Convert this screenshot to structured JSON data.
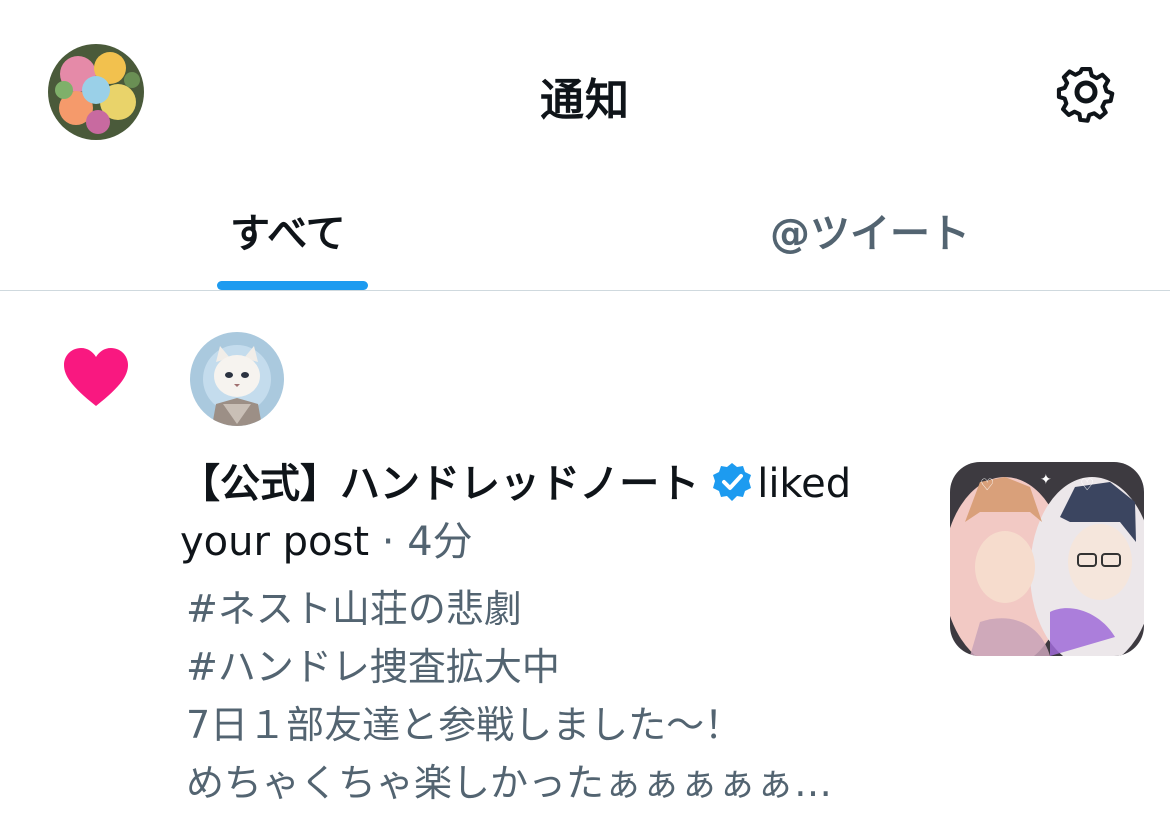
{
  "header": {
    "title": "通知",
    "settings_icon": "gear-icon",
    "avatar_icon": "profile-avatar"
  },
  "tabs": [
    {
      "label": "すべて",
      "selected": true
    },
    {
      "label": "@ツイート",
      "selected": false
    }
  ],
  "notification": {
    "type_icon": "heart-icon",
    "account_name": "【公式】ハンドレッドノート",
    "verified_icon": "verified-badge-icon",
    "action": "liked your post",
    "separator": "·",
    "time": "4分",
    "post_text": "#ネスト山荘の悲劇\n#ハンドレ捜査拡大中\n7日１部友達と参戦しました〜！\nめちゃくちゃ楽しかったぁぁぁぁぁ…"
  },
  "colors": {
    "accent": "#1d9bf0",
    "like": "#f91880",
    "muted_text": "#536471",
    "primary_text": "#0f1419",
    "divider": "#cfd9de"
  }
}
